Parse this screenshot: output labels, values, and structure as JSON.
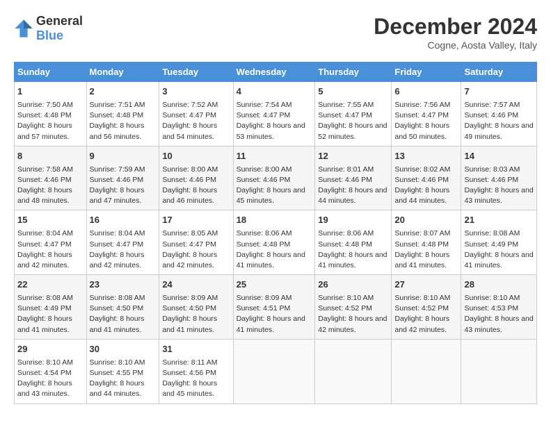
{
  "logo": {
    "general": "General",
    "blue": "Blue"
  },
  "title": "December 2024",
  "location": "Cogne, Aosta Valley, Italy",
  "weekdays": [
    "Sunday",
    "Monday",
    "Tuesday",
    "Wednesday",
    "Thursday",
    "Friday",
    "Saturday"
  ],
  "weeks": [
    [
      {
        "day": "1",
        "sunrise": "Sunrise: 7:50 AM",
        "sunset": "Sunset: 4:48 PM",
        "daylight": "Daylight: 8 hours and 57 minutes."
      },
      {
        "day": "2",
        "sunrise": "Sunrise: 7:51 AM",
        "sunset": "Sunset: 4:48 PM",
        "daylight": "Daylight: 8 hours and 56 minutes."
      },
      {
        "day": "3",
        "sunrise": "Sunrise: 7:52 AM",
        "sunset": "Sunset: 4:47 PM",
        "daylight": "Daylight: 8 hours and 54 minutes."
      },
      {
        "day": "4",
        "sunrise": "Sunrise: 7:54 AM",
        "sunset": "Sunset: 4:47 PM",
        "daylight": "Daylight: 8 hours and 53 minutes."
      },
      {
        "day": "5",
        "sunrise": "Sunrise: 7:55 AM",
        "sunset": "Sunset: 4:47 PM",
        "daylight": "Daylight: 8 hours and 52 minutes."
      },
      {
        "day": "6",
        "sunrise": "Sunrise: 7:56 AM",
        "sunset": "Sunset: 4:47 PM",
        "daylight": "Daylight: 8 hours and 50 minutes."
      },
      {
        "day": "7",
        "sunrise": "Sunrise: 7:57 AM",
        "sunset": "Sunset: 4:46 PM",
        "daylight": "Daylight: 8 hours and 49 minutes."
      }
    ],
    [
      {
        "day": "8",
        "sunrise": "Sunrise: 7:58 AM",
        "sunset": "Sunset: 4:46 PM",
        "daylight": "Daylight: 8 hours and 48 minutes."
      },
      {
        "day": "9",
        "sunrise": "Sunrise: 7:59 AM",
        "sunset": "Sunset: 4:46 PM",
        "daylight": "Daylight: 8 hours and 47 minutes."
      },
      {
        "day": "10",
        "sunrise": "Sunrise: 8:00 AM",
        "sunset": "Sunset: 4:46 PM",
        "daylight": "Daylight: 8 hours and 46 minutes."
      },
      {
        "day": "11",
        "sunrise": "Sunrise: 8:00 AM",
        "sunset": "Sunset: 4:46 PM",
        "daylight": "Daylight: 8 hours and 45 minutes."
      },
      {
        "day": "12",
        "sunrise": "Sunrise: 8:01 AM",
        "sunset": "Sunset: 4:46 PM",
        "daylight": "Daylight: 8 hours and 44 minutes."
      },
      {
        "day": "13",
        "sunrise": "Sunrise: 8:02 AM",
        "sunset": "Sunset: 4:46 PM",
        "daylight": "Daylight: 8 hours and 44 minutes."
      },
      {
        "day": "14",
        "sunrise": "Sunrise: 8:03 AM",
        "sunset": "Sunset: 4:46 PM",
        "daylight": "Daylight: 8 hours and 43 minutes."
      }
    ],
    [
      {
        "day": "15",
        "sunrise": "Sunrise: 8:04 AM",
        "sunset": "Sunset: 4:47 PM",
        "daylight": "Daylight: 8 hours and 42 minutes."
      },
      {
        "day": "16",
        "sunrise": "Sunrise: 8:04 AM",
        "sunset": "Sunset: 4:47 PM",
        "daylight": "Daylight: 8 hours and 42 minutes."
      },
      {
        "day": "17",
        "sunrise": "Sunrise: 8:05 AM",
        "sunset": "Sunset: 4:47 PM",
        "daylight": "Daylight: 8 hours and 42 minutes."
      },
      {
        "day": "18",
        "sunrise": "Sunrise: 8:06 AM",
        "sunset": "Sunset: 4:48 PM",
        "daylight": "Daylight: 8 hours and 41 minutes."
      },
      {
        "day": "19",
        "sunrise": "Sunrise: 8:06 AM",
        "sunset": "Sunset: 4:48 PM",
        "daylight": "Daylight: 8 hours and 41 minutes."
      },
      {
        "day": "20",
        "sunrise": "Sunrise: 8:07 AM",
        "sunset": "Sunset: 4:48 PM",
        "daylight": "Daylight: 8 hours and 41 minutes."
      },
      {
        "day": "21",
        "sunrise": "Sunrise: 8:08 AM",
        "sunset": "Sunset: 4:49 PM",
        "daylight": "Daylight: 8 hours and 41 minutes."
      }
    ],
    [
      {
        "day": "22",
        "sunrise": "Sunrise: 8:08 AM",
        "sunset": "Sunset: 4:49 PM",
        "daylight": "Daylight: 8 hours and 41 minutes."
      },
      {
        "day": "23",
        "sunrise": "Sunrise: 8:08 AM",
        "sunset": "Sunset: 4:50 PM",
        "daylight": "Daylight: 8 hours and 41 minutes."
      },
      {
        "day": "24",
        "sunrise": "Sunrise: 8:09 AM",
        "sunset": "Sunset: 4:50 PM",
        "daylight": "Daylight: 8 hours and 41 minutes."
      },
      {
        "day": "25",
        "sunrise": "Sunrise: 8:09 AM",
        "sunset": "Sunset: 4:51 PM",
        "daylight": "Daylight: 8 hours and 41 minutes."
      },
      {
        "day": "26",
        "sunrise": "Sunrise: 8:10 AM",
        "sunset": "Sunset: 4:52 PM",
        "daylight": "Daylight: 8 hours and 42 minutes."
      },
      {
        "day": "27",
        "sunrise": "Sunrise: 8:10 AM",
        "sunset": "Sunset: 4:52 PM",
        "daylight": "Daylight: 8 hours and 42 minutes."
      },
      {
        "day": "28",
        "sunrise": "Sunrise: 8:10 AM",
        "sunset": "Sunset: 4:53 PM",
        "daylight": "Daylight: 8 hours and 43 minutes."
      }
    ],
    [
      {
        "day": "29",
        "sunrise": "Sunrise: 8:10 AM",
        "sunset": "Sunset: 4:54 PM",
        "daylight": "Daylight: 8 hours and 43 minutes."
      },
      {
        "day": "30",
        "sunrise": "Sunrise: 8:10 AM",
        "sunset": "Sunset: 4:55 PM",
        "daylight": "Daylight: 8 hours and 44 minutes."
      },
      {
        "day": "31",
        "sunrise": "Sunrise: 8:11 AM",
        "sunset": "Sunset: 4:56 PM",
        "daylight": "Daylight: 8 hours and 45 minutes."
      },
      null,
      null,
      null,
      null
    ]
  ]
}
